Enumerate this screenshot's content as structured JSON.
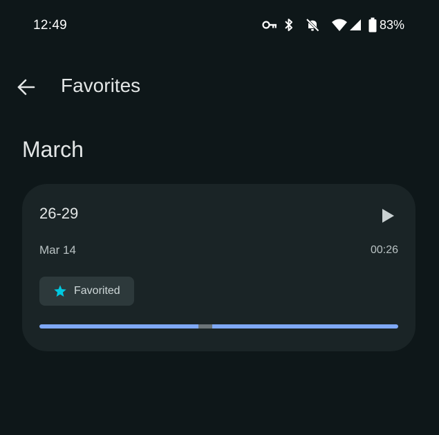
{
  "status_bar": {
    "time": "12:49",
    "battery_percent": "83%",
    "icons": [
      "vpn-key-icon",
      "bluetooth-icon",
      "mute-icon",
      "wifi-icon",
      "signal-icon",
      "battery-icon"
    ]
  },
  "app_bar": {
    "title": "Favorites",
    "back_icon": "arrow-back-icon"
  },
  "section": {
    "header": "March"
  },
  "recording": {
    "title": "26-29",
    "date": "Mar 14",
    "duration": "00:26",
    "chip_label": "Favorited",
    "play_icon": "play-icon",
    "chip_icon": "star-icon",
    "progress_marker_fraction": 0.46
  },
  "colors": {
    "background": "#0e1719",
    "card": "#1a2426",
    "chip": "#2d393b",
    "accent_star": "#00c8e0",
    "progress": "#7fa8f5"
  }
}
